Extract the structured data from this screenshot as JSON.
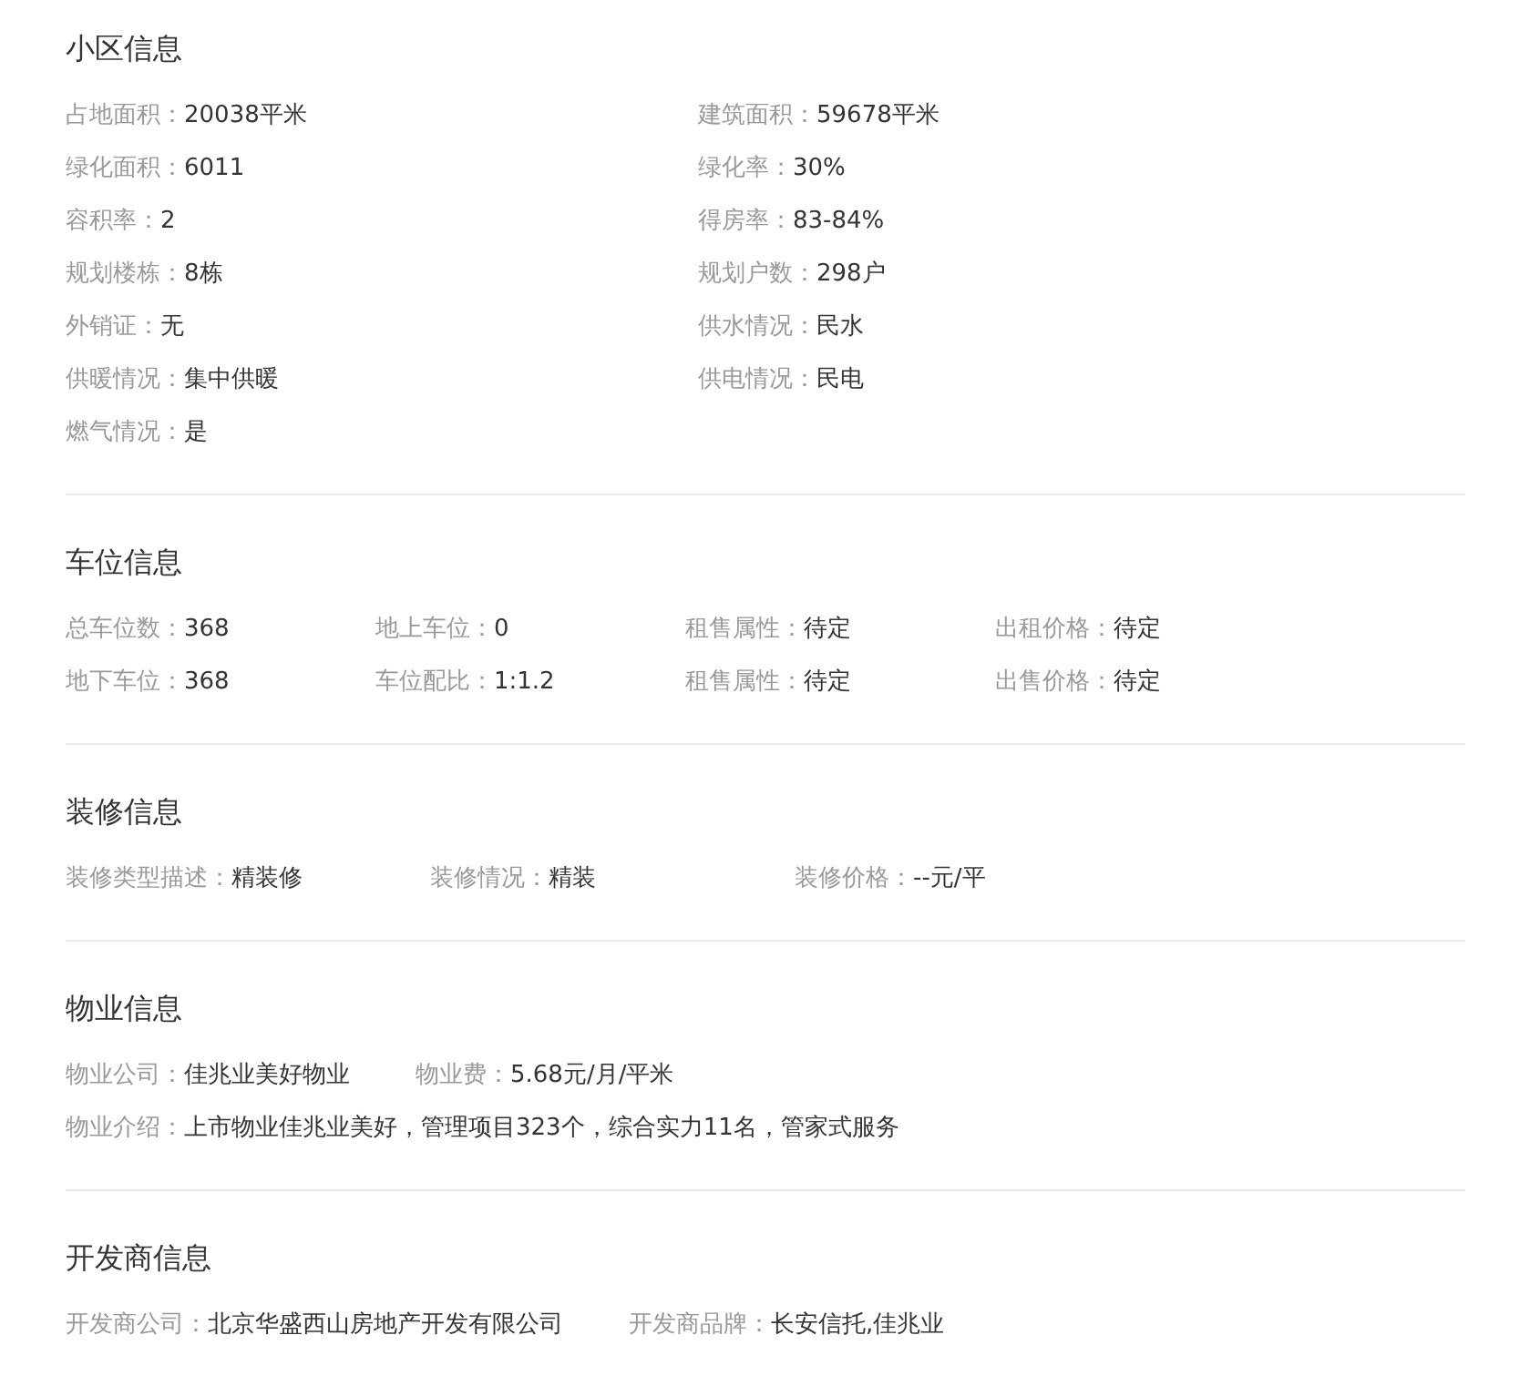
{
  "sections": [
    {
      "title": "小区信息",
      "kind": "two-column",
      "rows": [
        [
          {
            "label": "占地面积：",
            "value": "20038平米"
          },
          {
            "label": "建筑面积：",
            "value": "59678平米"
          }
        ],
        [
          {
            "label": "绿化面积：",
            "value": "6011"
          },
          {
            "label": "绿化率：",
            "value": "30%"
          }
        ],
        [
          {
            "label": "容积率：",
            "value": "2"
          },
          {
            "label": "得房率：",
            "value": "83-84%"
          }
        ],
        [
          {
            "label": "规划楼栋：",
            "value": "8栋"
          },
          {
            "label": "规划户数：",
            "value": "298户"
          }
        ],
        [
          {
            "label": "外销证：",
            "value": "无"
          },
          {
            "label": "供水情况：",
            "value": "民水"
          }
        ],
        [
          {
            "label": "供暖情况：",
            "value": "集中供暖"
          },
          {
            "label": "供电情况：",
            "value": "民电"
          }
        ],
        [
          {
            "label": "燃气情况：",
            "value": "是"
          }
        ]
      ]
    },
    {
      "title": "车位信息",
      "kind": "four-column",
      "rows": [
        [
          {
            "label": "总车位数：",
            "value": "368"
          },
          {
            "label": "地上车位：",
            "value": "0"
          },
          {
            "label": "租售属性：",
            "value": "待定"
          },
          {
            "label": "出租价格：",
            "value": "待定"
          }
        ],
        [
          {
            "label": "地下车位：",
            "value": "368"
          },
          {
            "label": "车位配比：",
            "value": "1:1.2"
          },
          {
            "label": "租售属性：",
            "value": "待定"
          },
          {
            "label": "出售价格：",
            "value": "待定"
          }
        ]
      ]
    },
    {
      "title": "装修信息",
      "kind": "three-column",
      "rows": [
        [
          {
            "label": "装修类型描述：",
            "value": "精装修"
          },
          {
            "label": "装修情况：",
            "value": "精装"
          },
          {
            "label": "装修价格：",
            "value": "--元/平"
          }
        ]
      ]
    },
    {
      "title": "物业信息",
      "kind": "flow",
      "rows": [
        [
          {
            "label": "物业公司：",
            "value": "佳兆业美好物业"
          },
          {
            "label": "物业费：",
            "value": "5.68元/月/平米"
          }
        ],
        [
          {
            "label": "物业介绍：",
            "value": "上市物业佳兆业美好，管理项目323个，综合实力11名，管家式服务"
          }
        ]
      ]
    },
    {
      "title": "开发商信息",
      "kind": "flow",
      "rows": [
        [
          {
            "label": "开发商公司：",
            "value": "北京华盛西山房地产开发有限公司"
          },
          {
            "label": "开发商品牌：",
            "value": "长安信托,佳兆业"
          }
        ]
      ]
    }
  ]
}
